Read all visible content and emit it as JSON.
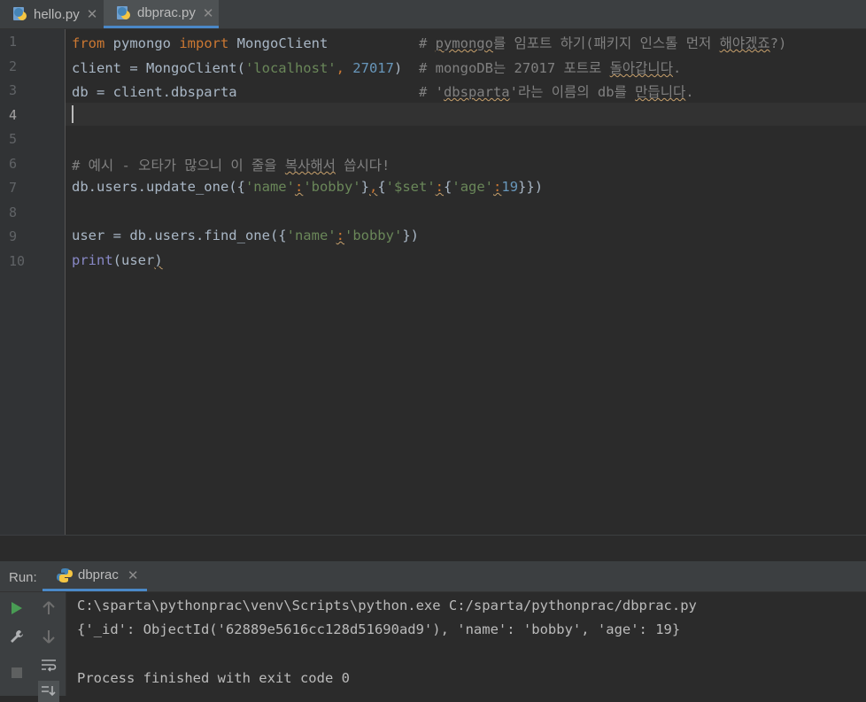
{
  "tabs": [
    {
      "label": "hello.py",
      "active": false
    },
    {
      "label": "dbprac.py",
      "active": true
    }
  ],
  "line_numbers": [
    "1",
    "2",
    "3",
    "4",
    "5",
    "6",
    "7",
    "8",
    "9",
    "10"
  ],
  "code": {
    "l1": {
      "kw_from": "from",
      "mod": " pymongo ",
      "kw_import": "import",
      "cls": " MongoClient",
      "pad": "           ",
      "comment_hash": "# ",
      "comment_sq": "pymongo",
      "comment_rest": "를 임포트 하기(패키지 인스톨 먼저 ",
      "comment_sq2": "해야겠죠",
      "comment_end": "?)"
    },
    "l2": {
      "a": "client = MongoClient(",
      "s": "'localhost'",
      "c": ", ",
      "n": "27017",
      "b": ")  ",
      "cmt": "# mongoDB는 27017 포트로 ",
      "cmt_sq": "돌아갑니다",
      "cmt_end": "."
    },
    "l3": {
      "a": "db = client.dbsparta",
      "pad": "                      ",
      "cmt": "# '",
      "cmt_sq": "dbsparta",
      "cmt_mid": "'라는 이름의 db를 ",
      "cmt_sq2": "만듭니다",
      "cmt_end": "."
    },
    "l6": {
      "cmt": "# 예시 - 오타가 많으니 이 줄을 ",
      "cmt_sq": "복사해서",
      "cmt_end": " 씁시다!"
    },
    "l7": {
      "a": "db.users.update_one({",
      "s1": "'name'",
      "c1": ":",
      "s2": "'bobby'",
      "b": "}",
      "c2": ",",
      "sp": "{",
      "s3": "'$set'",
      "c3": ":",
      "b2": "{",
      "s4": "'age'",
      "c4": ":",
      "n": "19",
      "end": "}})"
    },
    "l9": {
      "a": "user = db.users.find_one({",
      "s1": "'name'",
      "c1": ":",
      "s2": "'bobby'",
      "end": "})"
    },
    "l10": {
      "fn": "print",
      "a": "(user",
      ")": ")"
    }
  },
  "run": {
    "label": "Run:",
    "tab": "dbprac",
    "output": [
      "C:\\sparta\\pythonprac\\venv\\Scripts\\python.exe C:/sparta/pythonprac/dbprac.py",
      "{'_id': ObjectId('62889e5616cc128d51690ad9'), 'name': 'bobby', 'age': 19}",
      "",
      "Process finished with exit code 0"
    ]
  },
  "colors": {
    "accent": "#4a88c7",
    "keyword": "#cc7832",
    "string": "#6a8759",
    "number": "#6897bb",
    "comment": "#808080",
    "run_green": "#499c54"
  }
}
